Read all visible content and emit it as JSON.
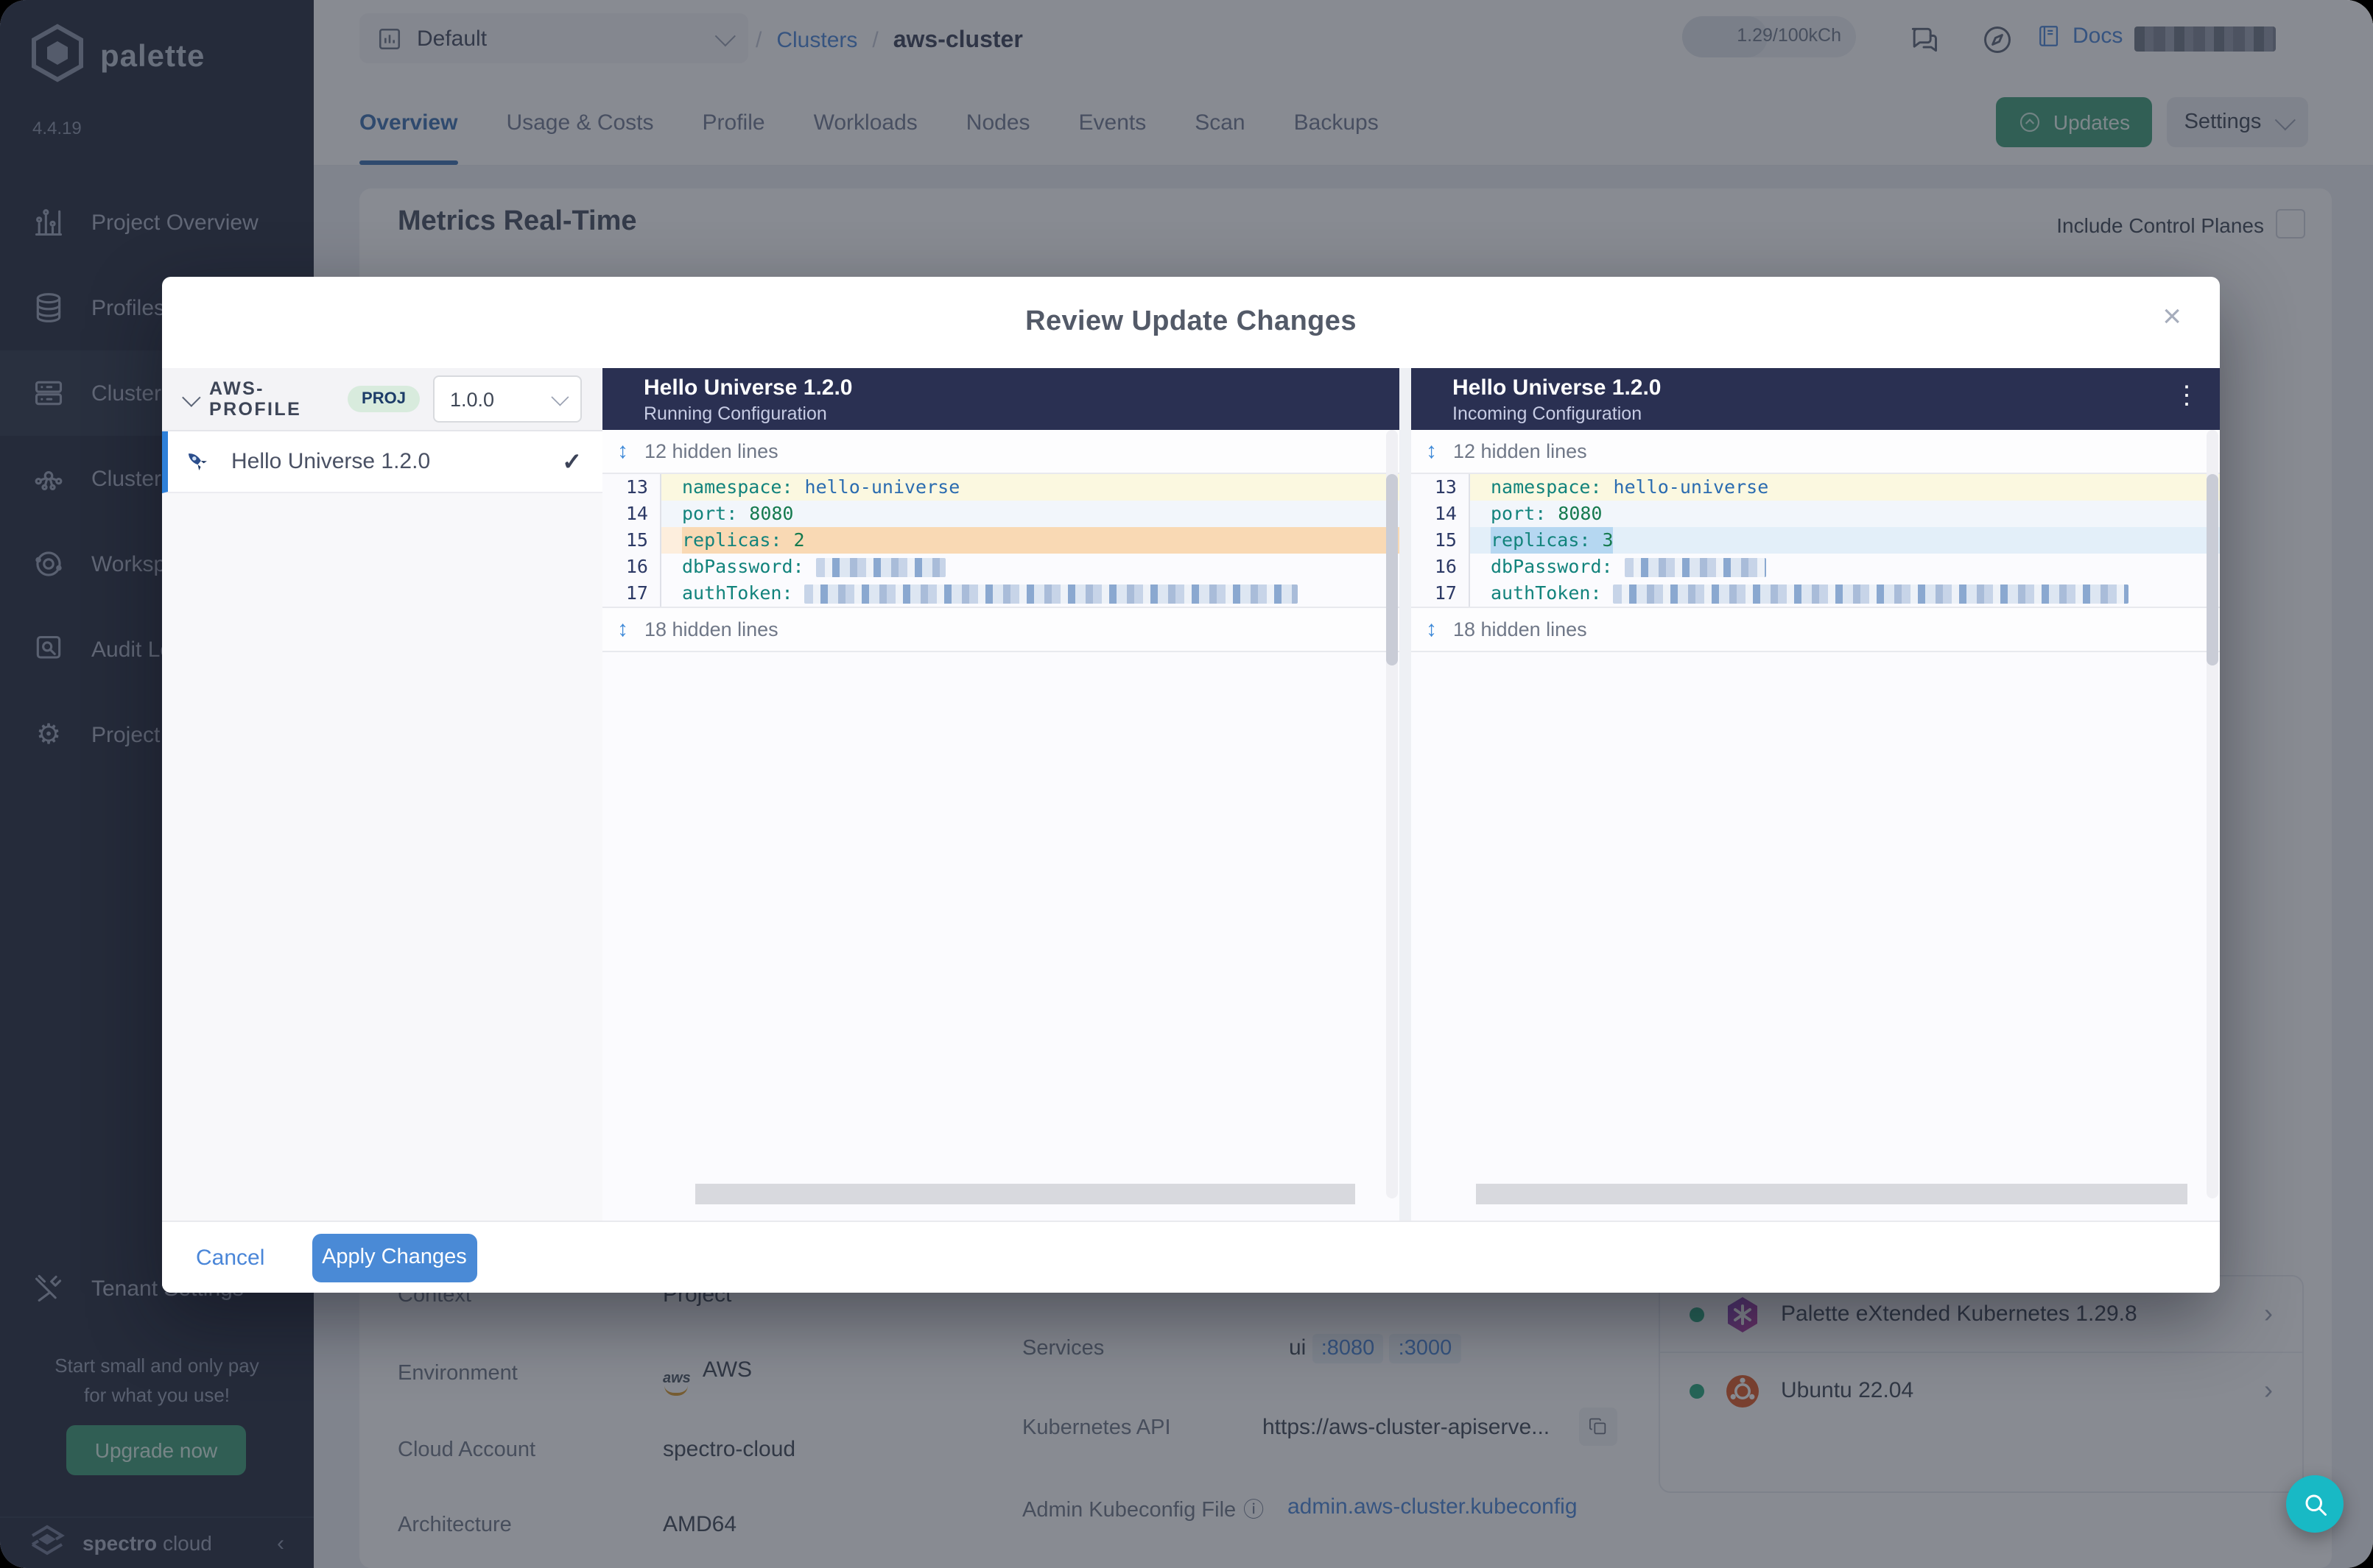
{
  "sidebar": {
    "brand": "palette",
    "version": "4.4.19",
    "items": [
      {
        "label": "Project Overview",
        "icon": "bar-chart-icon"
      },
      {
        "label": "Profiles",
        "icon": "stack-icon"
      },
      {
        "label": "Clusters",
        "icon": "servers-icon"
      },
      {
        "label": "Cluster Groups",
        "icon": "network-icon"
      },
      {
        "label": "Workspaces",
        "icon": "orbit-icon"
      },
      {
        "label": "Audit Logs",
        "icon": "audit-icon"
      },
      {
        "label": "Project Settings",
        "icon": "gear-icon"
      }
    ],
    "tenant": "Tenant Settings",
    "promo_line1": "Start small and only pay",
    "promo_line2": "for what you use!",
    "upgrade": "Upgrade now",
    "footer_brand_1": "spectro",
    "footer_brand_2": "cloud"
  },
  "topbar": {
    "project": "Default",
    "breadcrumb_sep": "/",
    "breadcrumb_section": "Clusters",
    "breadcrumb_current": "aws-cluster",
    "usage": "1.29/100kCh",
    "docs": "Docs"
  },
  "tabs": [
    {
      "label": "Overview"
    },
    {
      "label": "Usage & Costs"
    },
    {
      "label": "Profile"
    },
    {
      "label": "Workloads"
    },
    {
      "label": "Nodes"
    },
    {
      "label": "Events"
    },
    {
      "label": "Scan"
    },
    {
      "label": "Backups"
    }
  ],
  "actions": {
    "updates": "Updates",
    "settings": "Settings"
  },
  "main": {
    "metrics_title": "Metrics Real-Time",
    "include_control_planes": "Include Control Planes"
  },
  "details": {
    "rows_left": [
      {
        "label": "Context",
        "value": "Project"
      },
      {
        "label": "Environment",
        "value": "AWS"
      },
      {
        "label": "Cloud Account",
        "value": "spectro-cloud"
      },
      {
        "label": "Architecture",
        "value": "AMD64"
      }
    ],
    "rows_mid": [
      {
        "label": "Services",
        "value_prefix": "ui",
        "ports": [
          ":8080",
          ":3000"
        ]
      },
      {
        "label": "Kubernetes API",
        "value": "https://aws-cluster-apiserve..."
      },
      {
        "label": "Admin Kubeconfig File",
        "value": "admin.aws-cluster.kubeconfig"
      }
    ],
    "layers": [
      {
        "name": "Palette eXtended Kubernetes 1.29.8"
      },
      {
        "name": "Ubuntu 22.04"
      }
    ]
  },
  "modal": {
    "title": "Review Update Changes",
    "profile_header": {
      "name": "AWS-PROFILE",
      "scope_badge": "PROJ",
      "version": "1.0.0"
    },
    "pack_item": {
      "name": "Hello Universe 1.2.0"
    },
    "panels": [
      {
        "title": "Hello Universe 1.2.0",
        "subtitle": "Running Configuration",
        "hidden_top": "12 hidden lines",
        "hidden_bottom": "18 hidden lines",
        "lines": [
          {
            "num": "13",
            "key": "namespace:",
            "value": "hello-universe"
          },
          {
            "num": "14",
            "key": "port:",
            "value": "8080"
          },
          {
            "num": "15",
            "key": "replicas:",
            "value": "2"
          },
          {
            "num": "16",
            "key": "dbPassword:",
            "redacted": true
          },
          {
            "num": "17",
            "key": "authToken:",
            "redacted": true
          }
        ]
      },
      {
        "title": "Hello Universe 1.2.0",
        "subtitle": "Incoming Configuration",
        "hidden_top": "12 hidden lines",
        "hidden_bottom": "18 hidden lines",
        "lines": [
          {
            "num": "13",
            "key": "namespace:",
            "value": "hello-universe"
          },
          {
            "num": "14",
            "key": "port:",
            "value": "8080"
          },
          {
            "num": "15",
            "key": "replicas:",
            "value": "3"
          },
          {
            "num": "16",
            "key": "dbPassword:",
            "redacted": true
          },
          {
            "num": "17",
            "key": "authToken:",
            "redacted": true
          }
        ]
      }
    ],
    "footer": {
      "cancel": "Cancel",
      "apply": "Apply Changes"
    }
  },
  "colors": {
    "accent_blue": "#4A86D8",
    "action_green": "#3E9E78",
    "diff_header_navy": "#2A3052",
    "diff_removed_row": "#FDEEDD",
    "diff_removed_token": "#F9D9B4",
    "diff_added_row": "#E3EFF9",
    "diff_added_token": "#B5D7F1",
    "diff_context_yellow": "#FBF8E0",
    "fab_teal": "#18B9C5",
    "status_green": "#27A87C"
  }
}
